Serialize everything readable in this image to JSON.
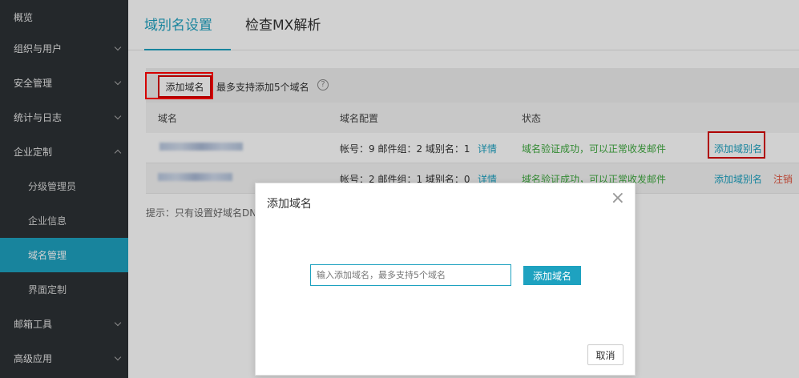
{
  "sidebar": {
    "items": [
      {
        "label": "概览"
      },
      {
        "label": "组织与用户"
      },
      {
        "label": "安全管理"
      },
      {
        "label": "统计与日志"
      },
      {
        "label": "企业定制"
      },
      {
        "label": "分级管理员"
      },
      {
        "label": "企业信息"
      },
      {
        "label": "域名管理"
      },
      {
        "label": "界面定制"
      },
      {
        "label": "邮箱工具"
      },
      {
        "label": "高级应用"
      }
    ]
  },
  "tabs": [
    {
      "label": "域别名设置"
    },
    {
      "label": "检查MX解析"
    }
  ],
  "toolbar": {
    "add_label": "添加域名",
    "note": "最多支持添加5个域名",
    "help": "?"
  },
  "table": {
    "headers": [
      "域名",
      "域名配置",
      "状态"
    ],
    "rows": [
      {
        "config": "帐号：9 邮件组：2 域别名：1",
        "detail": "详情",
        "status": "域名验证成功，可以正常收发邮件",
        "action1": "添加域别名"
      },
      {
        "config": "帐号：2 邮件组：1 域别名：0",
        "detail": "详情",
        "status": "域名验证成功，可以正常收发邮件",
        "action1": "添加域别名",
        "action2": "注销"
      }
    ]
  },
  "hint": "提示：只有设置好域名DN",
  "dialog": {
    "title": "添加域名",
    "close": "×",
    "input_placeholder": "输入添加域名，最多支持5个域名",
    "add_label": "添加域名",
    "cancel_label": "取消"
  },
  "colors": {
    "accent": "#1ea2c0",
    "sidebar_bg": "#2c3135",
    "highlight": "#d60000",
    "success": "#3fa93f"
  }
}
